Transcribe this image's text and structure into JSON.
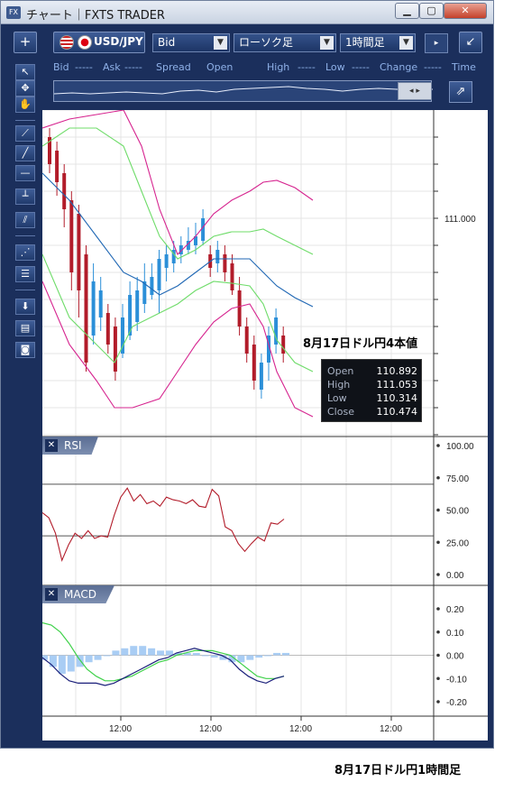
{
  "window": {
    "title": "チャート｜FXTS TRADER",
    "app_icon": "FX"
  },
  "toolbar": {
    "add_label": "+",
    "symbol": "USD/JPY",
    "price_type": "Bid",
    "chart_type": "ローソク足",
    "timeframe": "1時間足",
    "detach_icon": "↙"
  },
  "quote_header": {
    "bid": "Bid",
    "bid_val": "-----",
    "ask": "Ask",
    "ask_val": "-----",
    "spread": "Spread",
    "open": "Open",
    "high": "High",
    "high_val": "-----",
    "low": "Low",
    "low_val": "-----",
    "change": "Change",
    "change_val": "-----",
    "time": "Time"
  },
  "price_axis": {
    "label": "111.000"
  },
  "rsi": {
    "label": "RSI",
    "ticks": [
      "100.00",
      "75.00",
      "50.00",
      "25.00",
      "0.00"
    ],
    "values": [
      48,
      44,
      32,
      11,
      23,
      32,
      28,
      34,
      28,
      30,
      29,
      46,
      60,
      67,
      57,
      62,
      55,
      57,
      53,
      60,
      58,
      57,
      55,
      58,
      53,
      52,
      66,
      61,
      37,
      34,
      24,
      18,
      24,
      29,
      26,
      40,
      39,
      43
    ]
  },
  "macd": {
    "label": "MACD",
    "ticks": [
      "0.20",
      "0.10",
      "0.00",
      "-0.10",
      "-0.20"
    ],
    "macd_line": [
      -0.01,
      -0.04,
      -0.08,
      -0.11,
      -0.12,
      -0.12,
      -0.12,
      -0.13,
      -0.12,
      -0.1,
      -0.08,
      -0.06,
      -0.04,
      -0.02,
      -0.01,
      0.01,
      0.02,
      0.03,
      0.02,
      0.01,
      0.0,
      -0.02,
      -0.06,
      -0.09,
      -0.11,
      -0.12,
      -0.1,
      -0.09
    ],
    "signal_line": [
      0.14,
      0.13,
      0.1,
      0.05,
      -0.01,
      -0.06,
      -0.09,
      -0.11,
      -0.11,
      -0.1,
      -0.09,
      -0.07,
      -0.05,
      -0.03,
      -0.02,
      0.0,
      0.01,
      0.02,
      0.02,
      0.02,
      0.01,
      0.0,
      -0.03,
      -0.06,
      -0.09,
      -0.1,
      -0.1,
      -0.09
    ],
    "histogram": [
      -0.02,
      -0.05,
      -0.08,
      -0.07,
      -0.05,
      -0.03,
      -0.02,
      0.0,
      0.02,
      0.03,
      0.04,
      0.04,
      0.03,
      0.02,
      0.02,
      0.01,
      0.01,
      0.01,
      0.0,
      -0.01,
      -0.02,
      -0.03,
      -0.03,
      -0.02,
      -0.01,
      0.0,
      0.01,
      0.01
    ]
  },
  "time_axis": [
    "12:00",
    "12:00",
    "12:00",
    "12:00"
  ],
  "annotation": "8月17日ドル円4本値",
  "ohlc": [
    {
      "label": "Open",
      "value": "110.892"
    },
    {
      "label": "High",
      "value": "111.053"
    },
    {
      "label": "Low",
      "value": "110.314"
    },
    {
      "label": "Close",
      "value": "110.474"
    }
  ],
  "caption": "8月17日ドル円1時間足",
  "colors": {
    "bull": "#2b8fd8",
    "bear": "#b21c2a",
    "bb_outer": "#d6248f",
    "bb_inner": "#6fdc6a",
    "ma": "#1f67b4",
    "rsi": "#b21c2a",
    "macd": "#1a1f7a",
    "signal": "#3fd14a",
    "hist": "#a9cdf4"
  },
  "icons": {
    "tools": [
      "cursor-icon",
      "crosshair-icon",
      "hand-icon",
      "trendline-icon",
      "line-icon",
      "horizontal-line-icon",
      "vertical-line-icon",
      "channel-icon",
      "fibonacci-fan-icon",
      "fibonacci-retracement-icon",
      "download-icon",
      "list-icon",
      "camera-icon"
    ]
  }
}
